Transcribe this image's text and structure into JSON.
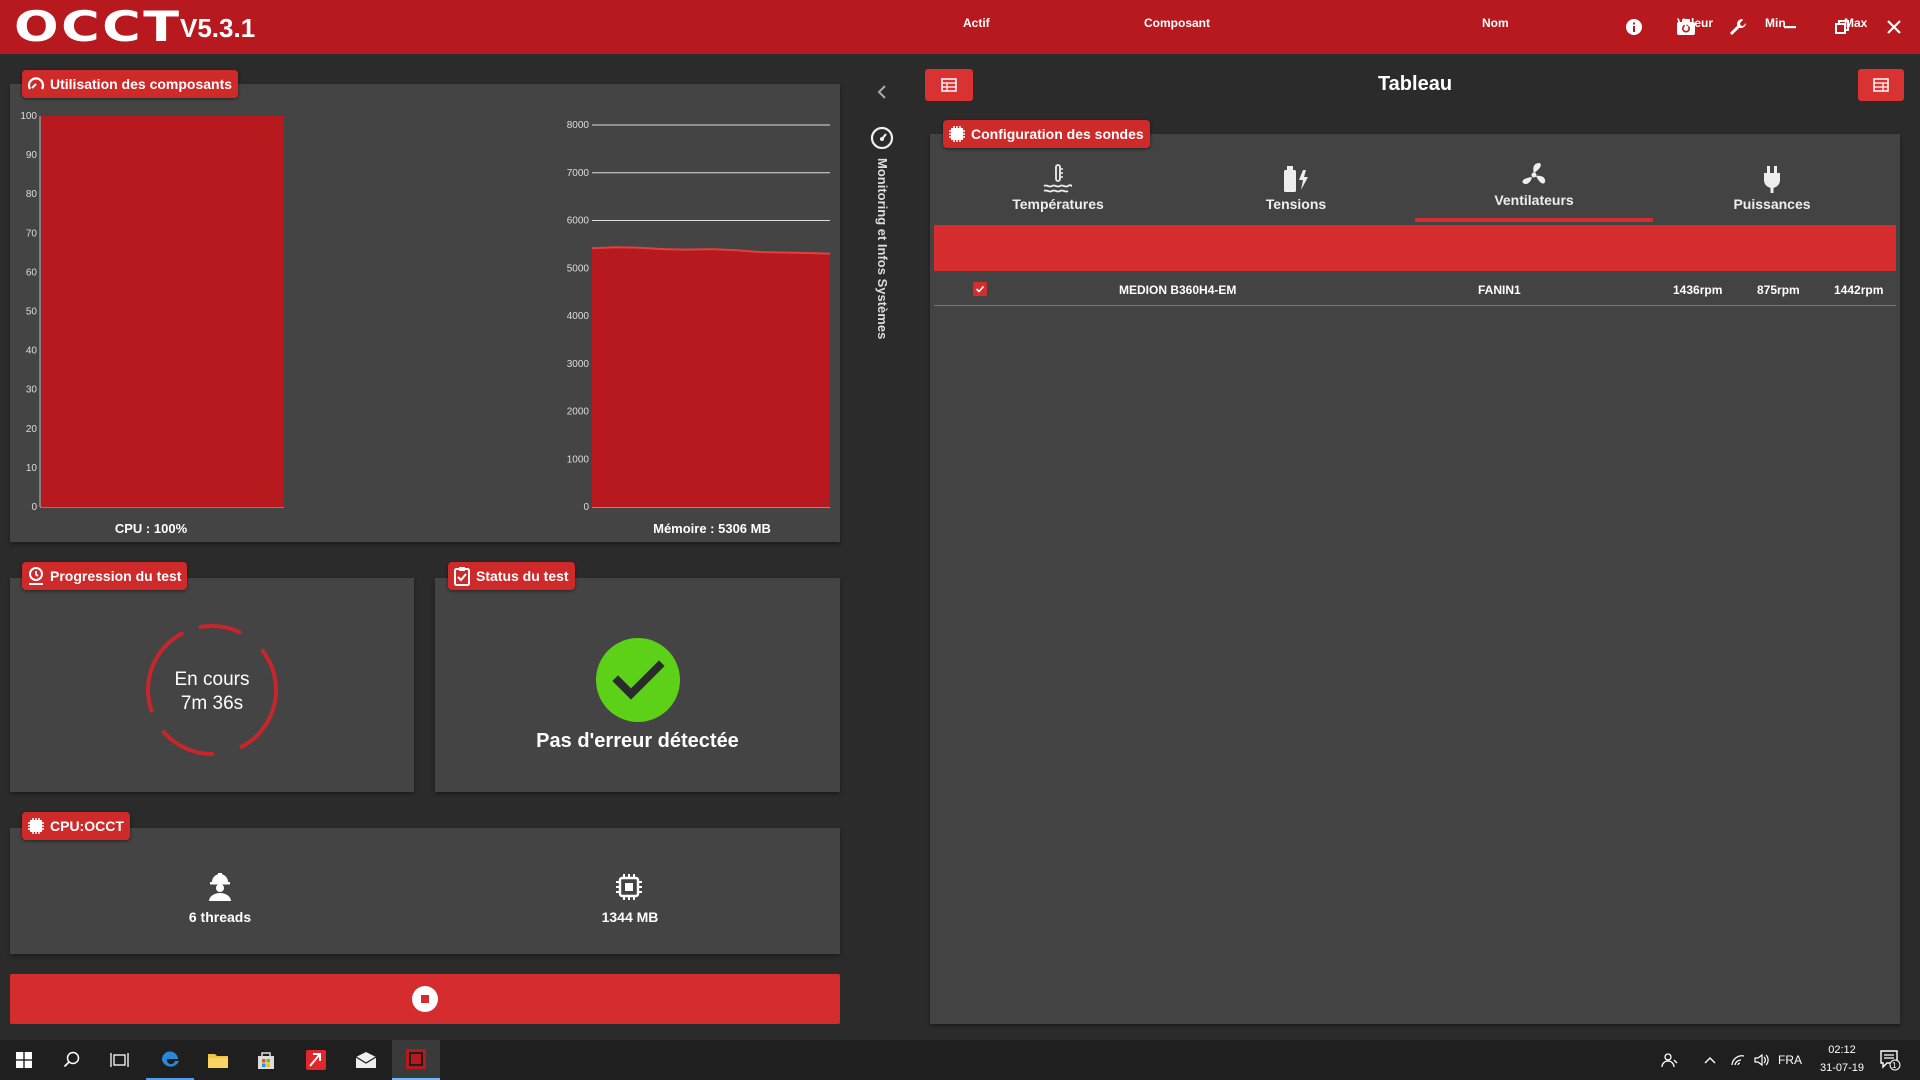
{
  "app": {
    "logo": "OCCT",
    "version": "V5.3.1"
  },
  "titlebar": {
    "icons": [
      "info-icon",
      "camera-icon",
      "wrench-icon",
      "minimize-icon",
      "restore-icon",
      "close-icon"
    ]
  },
  "usage": {
    "badge": "Utilisation des composants",
    "cpu_caption": "CPU : 100%",
    "mem_caption": "Mémoire : 5306 MB",
    "cpu_ticks": [
      "100",
      "90",
      "80",
      "70",
      "60",
      "50",
      "40",
      "30",
      "20",
      "10",
      "0"
    ],
    "mem_ticks": [
      "8000",
      "7000",
      "6000",
      "5000",
      "4000",
      "3000",
      "2000",
      "1000",
      "0"
    ]
  },
  "chart_data": [
    {
      "type": "bar",
      "categories": [
        "CPU"
      ],
      "values": [
        100
      ],
      "ylim": [
        0,
        100
      ],
      "xlabel": "CPU : 100%"
    },
    {
      "type": "area",
      "x": [
        0,
        1,
        2,
        3,
        4,
        5,
        6,
        7,
        8,
        9,
        10
      ],
      "values": [
        5420,
        5440,
        5430,
        5400,
        5390,
        5400,
        5380,
        5340,
        5330,
        5320,
        5306
      ],
      "ylim": [
        0,
        8000
      ],
      "xlabel": "Mémoire : 5306 MB"
    }
  ],
  "progress": {
    "badge": "Progression du test",
    "status": "En cours",
    "time": "7m 36s"
  },
  "status": {
    "badge": "Status du test",
    "message": "Pas d'erreur détectée"
  },
  "cpu_occt": {
    "badge": "CPU:OCCT",
    "threads": "6 threads",
    "memory": "1344 MB"
  },
  "sidebar": {
    "label": "Monitoring et Infos Systèmes"
  },
  "right": {
    "title": "Tableau",
    "badge": "Configuration des sondes",
    "tabs": [
      {
        "label": "Températures",
        "icon": "thermometer-icon"
      },
      {
        "label": "Tensions",
        "icon": "battery-icon"
      },
      {
        "label": "Ventilateurs",
        "icon": "fan-icon",
        "active": true
      },
      {
        "label": "Puissances",
        "icon": "plug-icon"
      }
    ],
    "table": {
      "headers": {
        "actif": "Actif",
        "composant": "Composant",
        "nom": "Nom",
        "valeur": "Valeur",
        "min": "Min",
        "max": "Max"
      },
      "rows": [
        {
          "actif": true,
          "composant": "MEDION B360H4-EM",
          "nom": "FANIN1",
          "valeur": "1436rpm",
          "min": "875rpm",
          "max": "1442rpm"
        }
      ]
    }
  },
  "taskbar": {
    "lang": "FRA",
    "time": "02:12",
    "date": "31-07-19",
    "notifications": "1"
  },
  "colors": {
    "accent": "#b8191e",
    "button": "#d93232",
    "panel": "#444444",
    "background": "#2b2b2b",
    "ok": "#5cd118"
  }
}
